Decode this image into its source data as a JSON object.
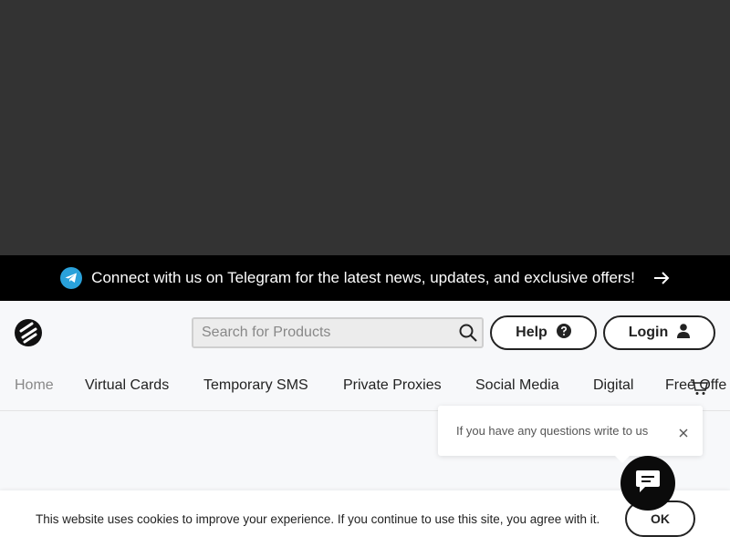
{
  "telegram_banner": {
    "text": "Connect with us on Telegram for the latest news, updates, and exclusive offers!"
  },
  "header": {
    "search_placeholder": "Search for Products",
    "help_label": "Help",
    "login_label": "Login"
  },
  "nav": {
    "items": [
      "Home",
      "Virtual Cards",
      "Temporary SMS",
      "Private Proxies",
      "Social Media",
      "Digital",
      "Free Offe"
    ]
  },
  "chat": {
    "popup_text": "If you have any questions write to us"
  },
  "cookie": {
    "text": "This website uses cookies to improve your experience. If you continue to use this site, you agree with it.",
    "ok_label": "OK"
  },
  "colors": {
    "dark_area": "#333333",
    "banner_bg": "#000000",
    "telegram_blue": "#2aa1da",
    "page_bg": "#f7f8fa"
  },
  "icons": [
    "telegram-icon",
    "arrow-right-icon",
    "logo-icon",
    "search-icon",
    "question-icon",
    "user-icon",
    "cart-icon",
    "close-icon",
    "chat-icon"
  ]
}
